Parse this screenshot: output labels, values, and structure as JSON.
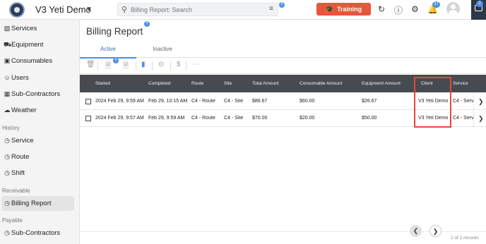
{
  "app": {
    "title": "V3 Yeti Demo"
  },
  "search": {
    "placeholder": "Billing Report: Search"
  },
  "header": {
    "training_label": "Training",
    "notification_count": "37",
    "chat_count": "2"
  },
  "sidebar": {
    "items_top": [
      {
        "label": "Services",
        "icon": "services-icon"
      },
      {
        "label": "Equipment",
        "icon": "truck-icon"
      },
      {
        "label": "Consumables",
        "icon": "box-icon"
      },
      {
        "label": "Users",
        "icon": "users-icon"
      },
      {
        "label": "Sub-Contractors",
        "icon": "sub-contractors-icon"
      },
      {
        "label": "Weather",
        "icon": "cloud-icon"
      }
    ],
    "history_label": "History",
    "history_items": [
      {
        "label": "Service",
        "icon": "history-service-icon"
      },
      {
        "label": "Route",
        "icon": "history-route-icon"
      },
      {
        "label": "Shift",
        "icon": "history-shift-icon"
      }
    ],
    "receivable_label": "Receivable",
    "receivable_items": [
      {
        "label": "Billing Report",
        "icon": "billing-report-icon",
        "active": true
      }
    ],
    "payable_label": "Payable",
    "payable_items": [
      {
        "label": "Sub-Contractors",
        "icon": "payable-sub-contractors-icon"
      }
    ]
  },
  "main": {
    "title": "Billing Report",
    "tabs": [
      {
        "label": "Active",
        "active": true
      },
      {
        "label": "Inactive",
        "active": false
      }
    ],
    "table": {
      "columns": [
        "Started",
        "Completed",
        "Route",
        "Site",
        "Total Amount",
        "Consumable Amount",
        "Equipment Amount",
        "Client",
        "Service"
      ],
      "rows": [
        {
          "started": "2024 Feb 29, 9:59 AM",
          "completed": "Feb 29, 10:15 AM",
          "route": "C4 - Route",
          "site": "C4 - Site",
          "total": "$86.67",
          "consumable": "$60.00",
          "equipment": "$26.67",
          "client": "V3 Yeti Demo",
          "service": "C4 - Serv"
        },
        {
          "started": "2024 Feb 29, 9:57 AM",
          "completed": "Feb 29, 9:59 AM",
          "route": "C4 - Route",
          "site": "C4 - Site",
          "total": "$70.00",
          "consumable": "$20.00",
          "equipment": "$50.00",
          "client": "V3 Yeti Demo",
          "service": "C4 - Serv"
        }
      ]
    },
    "records_text": "2 of 2 records"
  },
  "colors": {
    "accent": "#4a8fe0",
    "training": "#e8553a",
    "table_header": "#474a4f",
    "highlight": "#e14a3a"
  }
}
